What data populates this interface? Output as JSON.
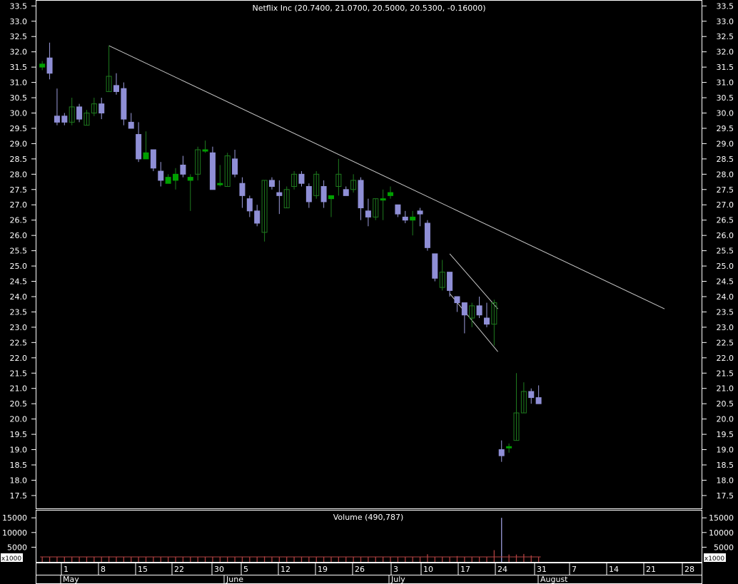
{
  "chart_data": {
    "type": "candlestick",
    "title": "Netflix Inc (20.7400, 21.0700, 20.5000, 20.5300, -0.16000)",
    "price_axis": {
      "ylim": [
        17.3,
        33.5
      ],
      "ticks": [
        "17.5",
        "18.0",
        "18.5",
        "19.0",
        "19.5",
        "20.0",
        "20.5",
        "21.0",
        "21.5",
        "22.0",
        "22.5",
        "23.0",
        "23.5",
        "24.0",
        "24.5",
        "25.0",
        "25.5",
        "26.0",
        "26.5",
        "27.0",
        "27.5",
        "28.0",
        "28.5",
        "29.0",
        "29.5",
        "30.0",
        "30.5",
        "31.0",
        "31.5",
        "32.0",
        "32.5",
        "33.0",
        "33.5"
      ]
    },
    "volume_panel": {
      "label": "Volume (490,787)",
      "ylim": [
        0,
        16500
      ],
      "ticks": [
        "5000",
        "10000",
        "15000"
      ],
      "multiplier_label": "x1000"
    },
    "date_ticks": [
      "1",
      "8",
      "15",
      "22",
      "30",
      "5",
      "12",
      "19",
      "26",
      "3",
      "10",
      "17",
      "24",
      "31",
      "7",
      "14",
      "21",
      "28"
    ],
    "month_labels": [
      "May",
      "June",
      "July",
      "August"
    ],
    "candles": [
      {
        "i": 1,
        "o": 31.5,
        "h": 31.7,
        "l": 31.4,
        "c": 31.6
      },
      {
        "i": 2,
        "o": 31.8,
        "h": 32.3,
        "l": 31.1,
        "c": 31.3
      },
      {
        "i": 3,
        "o": 29.9,
        "h": 30.8,
        "l": 29.6,
        "c": 29.7
      },
      {
        "i": 4,
        "o": 29.9,
        "h": 30.0,
        "l": 29.6,
        "c": 29.7
      },
      {
        "i": 5,
        "o": 29.7,
        "h": 30.5,
        "l": 29.6,
        "c": 30.2
      },
      {
        "i": 6,
        "o": 30.2,
        "h": 30.3,
        "l": 29.7,
        "c": 29.8
      },
      {
        "i": 7,
        "o": 29.6,
        "h": 30.1,
        "l": 29.6,
        "c": 30.0
      },
      {
        "i": 8,
        "o": 30.0,
        "h": 30.5,
        "l": 29.9,
        "c": 30.3
      },
      {
        "i": 9,
        "o": 30.3,
        "h": 30.5,
        "l": 29.8,
        "c": 30.0
      },
      {
        "i": 10,
        "o": 30.7,
        "h": 32.2,
        "l": 30.7,
        "c": 31.2
      },
      {
        "i": 11,
        "o": 30.9,
        "h": 31.3,
        "l": 30.6,
        "c": 30.7
      },
      {
        "i": 12,
        "o": 30.8,
        "h": 31.0,
        "l": 29.6,
        "c": 29.8
      },
      {
        "i": 13,
        "o": 29.7,
        "h": 30.0,
        "l": 29.5,
        "c": 29.5
      },
      {
        "i": 14,
        "o": 29.3,
        "h": 29.7,
        "l": 28.4,
        "c": 28.5
      },
      {
        "i": 15,
        "o": 28.5,
        "h": 29.4,
        "l": 28.5,
        "c": 28.7
      },
      {
        "i": 16,
        "o": 28.8,
        "h": 28.8,
        "l": 28.1,
        "c": 28.2
      },
      {
        "i": 17,
        "o": 28.1,
        "h": 28.4,
        "l": 27.6,
        "c": 27.8
      },
      {
        "i": 18,
        "o": 27.7,
        "h": 28.0,
        "l": 27.7,
        "c": 27.9
      },
      {
        "i": 19,
        "o": 27.8,
        "h": 28.2,
        "l": 27.5,
        "c": 28.0
      },
      {
        "i": 20,
        "o": 28.3,
        "h": 28.6,
        "l": 27.9,
        "c": 28.0
      },
      {
        "i": 21,
        "o": 27.8,
        "h": 28.0,
        "l": 26.8,
        "c": 27.9
      },
      {
        "i": 22,
        "o": 28.0,
        "h": 28.9,
        "l": 27.8,
        "c": 28.8
      },
      {
        "i": 23,
        "o": 28.8,
        "h": 29.1,
        "l": 28.7,
        "c": 28.8
      },
      {
        "i": 24,
        "o": 28.7,
        "h": 28.9,
        "l": 27.5,
        "c": 27.5
      },
      {
        "i": 25,
        "o": 27.7,
        "h": 28.3,
        "l": 27.6,
        "c": 27.7
      },
      {
        "i": 26,
        "o": 27.6,
        "h": 28.7,
        "l": 27.6,
        "c": 28.6
      },
      {
        "i": 27,
        "o": 28.5,
        "h": 28.8,
        "l": 27.9,
        "c": 28.0
      },
      {
        "i": 28,
        "o": 27.7,
        "h": 27.9,
        "l": 26.9,
        "c": 27.3
      },
      {
        "i": 29,
        "o": 27.2,
        "h": 27.3,
        "l": 26.6,
        "c": 26.8
      },
      {
        "i": 30,
        "o": 26.8,
        "h": 27.0,
        "l": 26.3,
        "c": 26.4
      },
      {
        "i": 31,
        "o": 26.1,
        "h": 27.8,
        "l": 25.8,
        "c": 27.8
      },
      {
        "i": 32,
        "o": 27.8,
        "h": 27.9,
        "l": 27.5,
        "c": 27.6
      },
      {
        "i": 33,
        "o": 27.4,
        "h": 27.8,
        "l": 26.7,
        "c": 27.3
      },
      {
        "i": 34,
        "o": 26.9,
        "h": 27.6,
        "l": 26.9,
        "c": 27.5
      },
      {
        "i": 35,
        "o": 27.6,
        "h": 28.1,
        "l": 27.5,
        "c": 28.0
      },
      {
        "i": 36,
        "o": 28.0,
        "h": 28.1,
        "l": 27.6,
        "c": 27.7
      },
      {
        "i": 37,
        "o": 27.6,
        "h": 27.7,
        "l": 26.9,
        "c": 27.1
      },
      {
        "i": 38,
        "o": 27.3,
        "h": 28.1,
        "l": 27.2,
        "c": 28.0
      },
      {
        "i": 39,
        "o": 27.6,
        "h": 27.8,
        "l": 26.9,
        "c": 27.1
      },
      {
        "i": 40,
        "o": 27.2,
        "h": 27.3,
        "l": 26.6,
        "c": 27.3
      },
      {
        "i": 41,
        "o": 27.6,
        "h": 28.5,
        "l": 27.3,
        "c": 28.0
      },
      {
        "i": 42,
        "o": 27.5,
        "h": 27.6,
        "l": 27.3,
        "c": 27.3
      },
      {
        "i": 43,
        "o": 27.5,
        "h": 28.0,
        "l": 27.4,
        "c": 27.8
      },
      {
        "i": 44,
        "o": 27.8,
        "h": 27.9,
        "l": 26.5,
        "c": 26.9
      },
      {
        "i": 45,
        "o": 26.8,
        "h": 27.2,
        "l": 26.3,
        "c": 26.6
      },
      {
        "i": 46,
        "o": 26.6,
        "h": 27.2,
        "l": 26.5,
        "c": 27.2
      },
      {
        "i": 47,
        "o": 27.2,
        "h": 27.5,
        "l": 26.5,
        "c": 27.2
      },
      {
        "i": 48,
        "o": 27.3,
        "h": 27.6,
        "l": 27.2,
        "c": 27.4
      },
      {
        "i": 49,
        "o": 27.0,
        "h": 27.0,
        "l": 26.6,
        "c": 26.7
      },
      {
        "i": 50,
        "o": 26.6,
        "h": 26.8,
        "l": 26.4,
        "c": 26.5
      },
      {
        "i": 51,
        "o": 26.5,
        "h": 26.8,
        "l": 26.0,
        "c": 26.6
      },
      {
        "i": 52,
        "o": 26.8,
        "h": 26.9,
        "l": 26.3,
        "c": 26.7
      },
      {
        "i": 53,
        "o": 26.4,
        "h": 26.5,
        "l": 25.5,
        "c": 25.6
      },
      {
        "i": 54,
        "o": 25.4,
        "h": 25.4,
        "l": 24.5,
        "c": 24.6
      },
      {
        "i": 55,
        "o": 24.3,
        "h": 25.2,
        "l": 24.2,
        "c": 24.8
      },
      {
        "i": 56,
        "o": 24.8,
        "h": 24.8,
        "l": 24.0,
        "c": 24.2
      },
      {
        "i": 57,
        "o": 24.0,
        "h": 24.0,
        "l": 23.5,
        "c": 23.8
      },
      {
        "i": 58,
        "o": 23.8,
        "h": 23.8,
        "l": 22.8,
        "c": 23.4
      },
      {
        "i": 59,
        "o": 23.3,
        "h": 23.8,
        "l": 23.0,
        "c": 23.7
      },
      {
        "i": 60,
        "o": 23.7,
        "h": 24.0,
        "l": 23.3,
        "c": 23.4
      },
      {
        "i": 61,
        "o": 23.3,
        "h": 23.8,
        "l": 23.0,
        "c": 23.1
      },
      {
        "i": 62,
        "o": 23.1,
        "h": 23.9,
        "l": 22.4,
        "c": 23.8
      },
      {
        "i": 63,
        "o": 19.0,
        "h": 19.3,
        "l": 18.6,
        "c": 18.8
      },
      {
        "i": 64,
        "o": 19.1,
        "h": 19.2,
        "l": 18.9,
        "c": 19.1
      },
      {
        "i": 65,
        "o": 19.3,
        "h": 21.5,
        "l": 19.3,
        "c": 20.2
      },
      {
        "i": 66,
        "o": 20.2,
        "h": 21.2,
        "l": 20.2,
        "c": 20.9
      },
      {
        "i": 67,
        "o": 20.9,
        "h": 21.0,
        "l": 20.5,
        "c": 20.7
      },
      {
        "i": 68,
        "o": 20.7,
        "h": 21.1,
        "l": 20.5,
        "c": 20.5
      }
    ],
    "volume_values": [
      1800,
      1800,
      1700,
      1700,
      1800,
      1700,
      1700,
      1700,
      1700,
      1900,
      1800,
      1800,
      1700,
      1800,
      1700,
      1700,
      1700,
      1700,
      1700,
      1700,
      1700,
      1700,
      1700,
      1700,
      1700,
      1700,
      1700,
      1700,
      1700,
      1700,
      1900,
      1700,
      1700,
      1700,
      1700,
      1700,
      1700,
      1700,
      1700,
      1700,
      1800,
      1700,
      1700,
      1700,
      1700,
      1700,
      1700,
      1700,
      1700,
      1700,
      1700,
      1700,
      2600,
      1800,
      1700,
      1700,
      2000,
      1800,
      1800,
      1800,
      1800,
      4000,
      15000,
      2500,
      2500,
      2700,
      2200,
      1800
    ],
    "trendlines": [
      {
        "x1_index": 10,
        "y1": 32.2,
        "x2_index": 85,
        "y2": 23.6
      },
      {
        "x1_index": 56,
        "y1": 25.4,
        "x2_index": 62.5,
        "y2": 23.6
      },
      {
        "x1_index": 56,
        "y1": 24.1,
        "x2_index": 62.5,
        "y2": 22.2
      }
    ],
    "colors": {
      "bear_fill": "#8f8fd6",
      "bull_fill": "#00a000",
      "bull_hollow": "#1e7a1e",
      "wick": "#9b9bdb",
      "volume": "#b04040",
      "trend": "#c8c8c8",
      "grid_text": "#ffffff"
    }
  }
}
